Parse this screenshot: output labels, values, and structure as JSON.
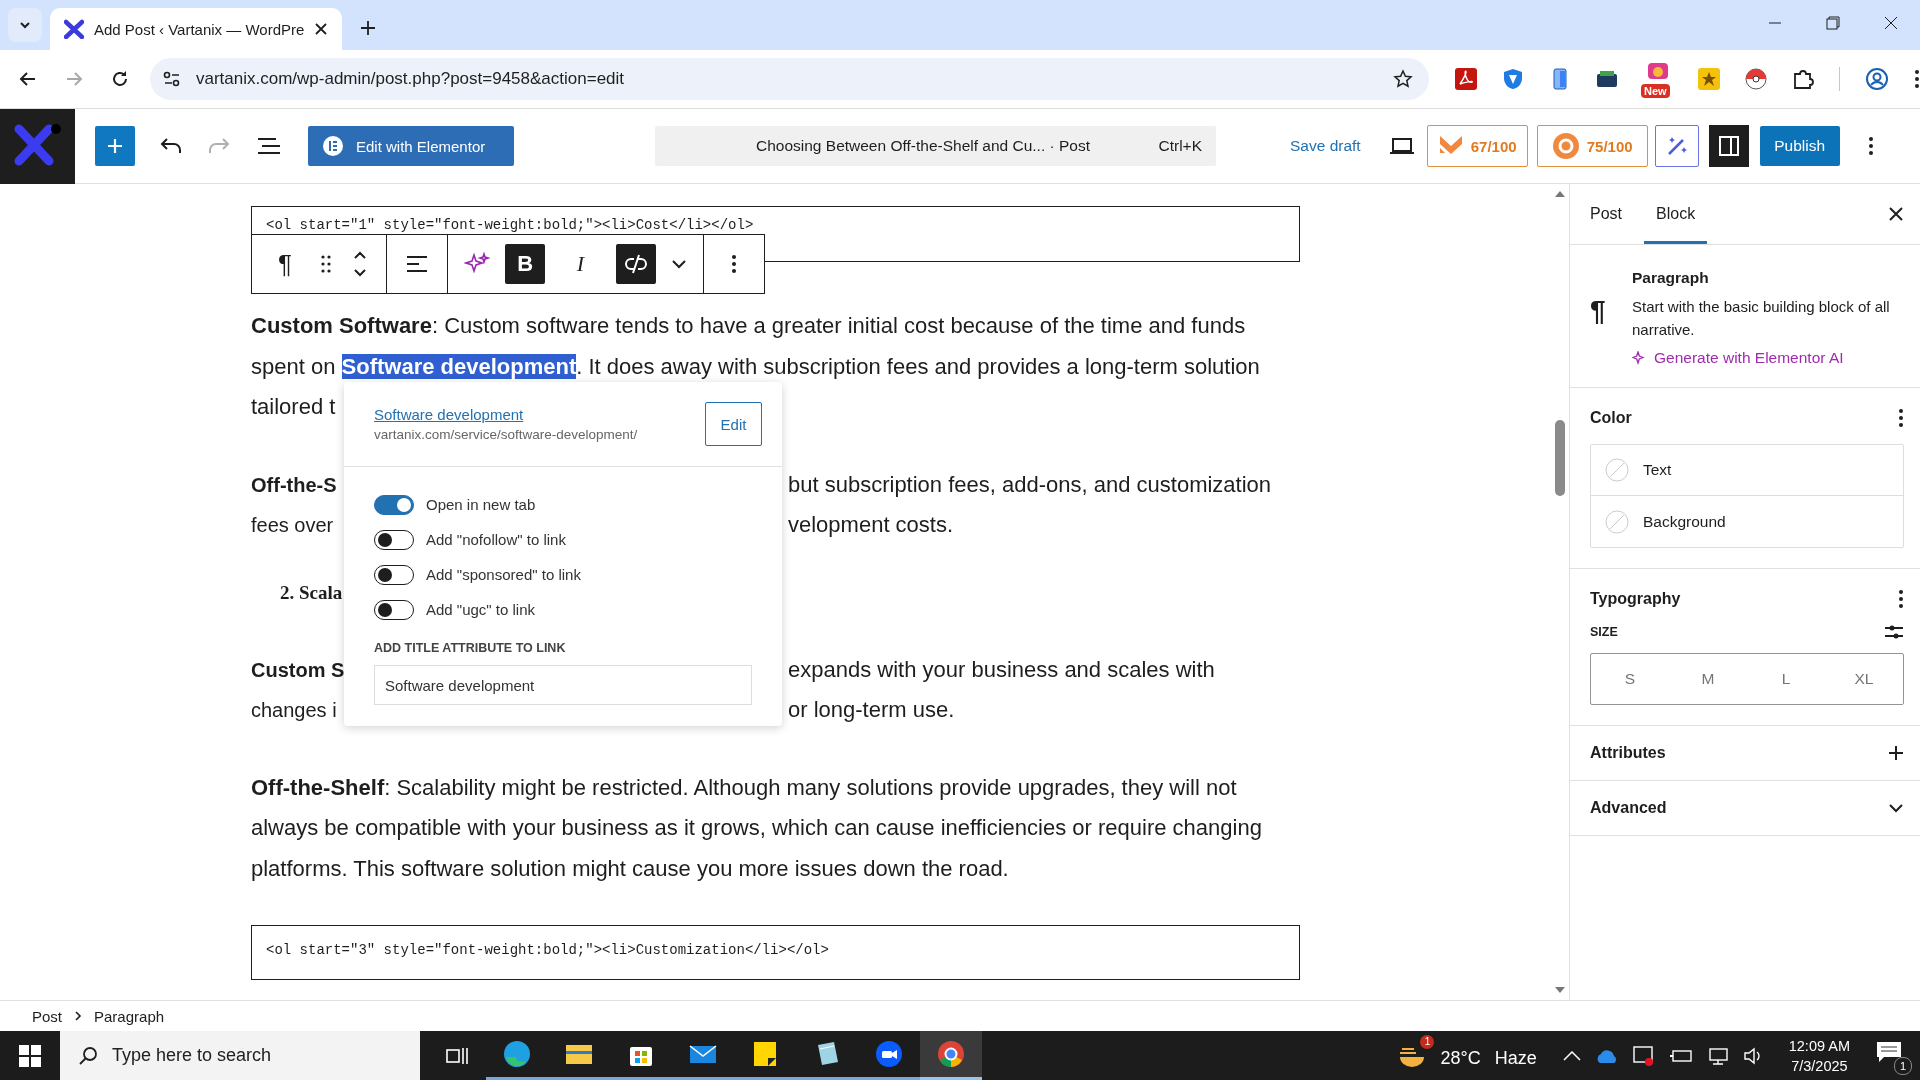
{
  "browser": {
    "tab_title": "Add Post ‹ Vartanix — WordPre",
    "url": "vartanix.com/wp-admin/post.php?post=9458&action=edit",
    "forward_enabled": false,
    "extension_badge": "New"
  },
  "toolbar": {
    "redo_enabled": false,
    "elementor_button": "Edit with Elementor",
    "command_title": "Choosing Between Off-the-Shelf and Cu... · Post",
    "shortcut": "Ctrl+K",
    "save_draft": "Save draft",
    "scores": [
      {
        "kind": "seo",
        "label": "67/100"
      },
      {
        "kind": "readability",
        "label": "75/100"
      }
    ],
    "sidebar_open": true,
    "publish": "Publish"
  },
  "block_toolbar": {
    "block_icon": "¶",
    "bold": {
      "label": "B",
      "on": true
    },
    "italic": {
      "label": "I",
      "on": false
    },
    "link_on": true
  },
  "editor": {
    "blocks": [
      {
        "kind": "code",
        "text": "<ol start=\"1\" style=\"font-weight:bold;\"><li>Cost</li></ol>"
      },
      {
        "kind": "paragraph",
        "lines": [
          {
            "text": "**Custom Software**: Custom software tends to have a greater initial cost because of the time and funds"
          },
          {
            "text": "spent on ",
            "link": "Software development",
            "after": ". It does away with subscription fees and provides a long-term solution"
          },
          {
            "text": "tailored t"
          }
        ]
      },
      {
        "kind": "paragraph",
        "lines": [
          {
            "text": "**Off-the-S**",
            "right": "but subscription fees, add-ons, and customization"
          },
          {
            "text": "fees over",
            "right": "velopment costs."
          }
        ]
      },
      {
        "kind": "list_item",
        "text": "2. Scala"
      },
      {
        "kind": "paragraph",
        "lines": [
          {
            "text": "**Custom S**",
            "right": "expands with your business and scales with"
          },
          {
            "text": "changes i",
            "right": "or long-term use."
          }
        ]
      },
      {
        "kind": "paragraph",
        "lines": [
          {
            "text": "**Off-the-Shelf**: Scalability might be restricted. Although many solutions provide upgrades, they will not"
          },
          {
            "text": "always be compatible with your business as it grows, which can cause inefficiencies or require changing"
          },
          {
            "text": "platforms. This software solution might cause you more issues down the road."
          }
        ]
      },
      {
        "kind": "code",
        "text": "<ol start=\"3\" style=\"font-weight:bold;\"><li>Customization</li></ol>"
      }
    ]
  },
  "link_popover": {
    "title": "Software development",
    "url": "vartanix.com/service/software-development/",
    "edit": "Edit",
    "options": [
      {
        "label": "Open in new tab",
        "on": true
      },
      {
        "label": "Add \"nofollow\" to link",
        "on": false
      },
      {
        "label": "Add \"sponsored\" to link",
        "on": false
      },
      {
        "label": "Add \"ugc\" to link",
        "on": false
      }
    ],
    "title_attribute_label": "ADD TITLE ATTRIBUTE TO LINK",
    "title_attribute_value": "Software development"
  },
  "sidebar": {
    "tabs": [
      {
        "label": "Post",
        "selected": false
      },
      {
        "label": "Block",
        "selected": true
      }
    ],
    "block": {
      "icon": "¶",
      "name": "Paragraph",
      "description": "Start with the basic building block of all narrative.",
      "ai_link": "Generate with Elementor AI"
    },
    "color": {
      "title": "Color",
      "items": [
        "Text",
        "Background"
      ]
    },
    "typography": {
      "title": "Typography",
      "size_label": "SIZE",
      "sizes": [
        {
          "label": "S",
          "selected": false
        },
        {
          "label": "M",
          "selected": false
        },
        {
          "label": "L",
          "selected": false
        },
        {
          "label": "XL",
          "selected": false
        }
      ]
    },
    "panels": [
      {
        "title": "Attributes",
        "kind": "add"
      },
      {
        "title": "Advanced",
        "kind": "collapsed"
      }
    ]
  },
  "breadcrumb": [
    "Post",
    "Paragraph"
  ],
  "taskbar": {
    "search_placeholder": "Type here to search",
    "apps": [
      {
        "kind": "edge",
        "active": false
      },
      {
        "kind": "folder",
        "active": false
      },
      {
        "kind": "store",
        "active": false
      },
      {
        "kind": "mail",
        "active": false
      },
      {
        "kind": "notes",
        "active": false
      },
      {
        "kind": "notepad",
        "active": false
      },
      {
        "kind": "zoom",
        "active": false
      },
      {
        "kind": "chrome",
        "active": true
      }
    ],
    "weather_badge": "1",
    "temperature": "28°C",
    "condition": "Haze",
    "time": "12:09 AM",
    "date": "7/3/2025",
    "notifications": "1"
  }
}
